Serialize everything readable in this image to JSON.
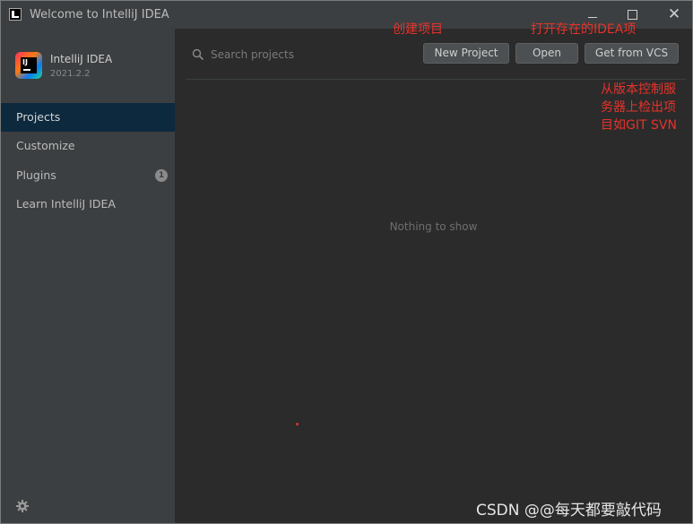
{
  "window": {
    "title": "Welcome to IntelliJ IDEA",
    "controls": {
      "minimize": "minimize-icon",
      "maximize": "maximize-icon",
      "close": "✕"
    }
  },
  "sidebar": {
    "product_name": "IntelliJ IDEA",
    "product_version": "2021.2.2",
    "items": [
      {
        "label": "Projects",
        "selected": true
      },
      {
        "label": "Customize",
        "selected": false
      },
      {
        "label": "Plugins",
        "selected": false,
        "badge": "1"
      },
      {
        "label": "Learn IntelliJ IDEA",
        "selected": false
      }
    ],
    "settings_icon": "gear-icon"
  },
  "main": {
    "search": {
      "placeholder": "Search projects",
      "value": ""
    },
    "buttons": {
      "new_project": "New Project",
      "open": "Open",
      "get_from_vcs": "Get from VCS"
    },
    "empty_text": "Nothing to show"
  },
  "annotations": {
    "new_project": "创建项目",
    "open": "打开存在的IDEA项",
    "vcs_line1": "从版本控制服",
    "vcs_line2": "务器上检出项",
    "vcs_line3": "目如GIT SVN"
  },
  "watermark": "CSDN @@每天都要敲代码",
  "colors": {
    "background": "#2b2b2b",
    "sidebar": "#3c3f41",
    "selected": "#0d293e",
    "annotation": "#e8322a"
  }
}
